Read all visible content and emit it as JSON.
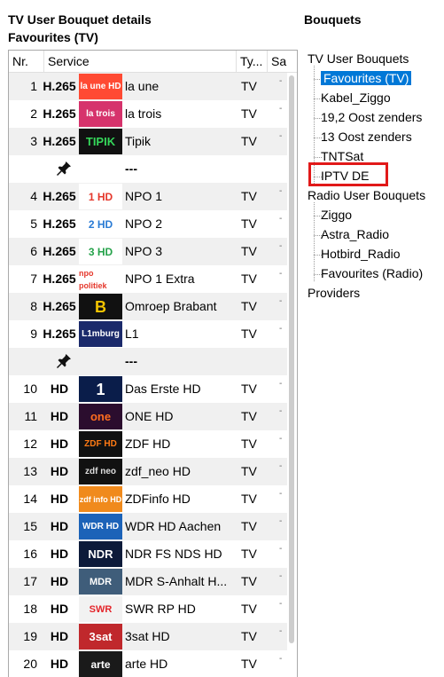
{
  "header": {
    "title": "TV User Bouquet details",
    "subtitle": "Favourites (TV)"
  },
  "bouquets_title": "Bouquets",
  "columns": {
    "nr": "Nr.",
    "service": "Service",
    "type": "Ty...",
    "sat": "Sa"
  },
  "rows": [
    {
      "nr": "1",
      "badge": "H.265",
      "logo": "la une HD",
      "name": "la une",
      "type": "TV"
    },
    {
      "nr": "2",
      "badge": "H.265",
      "logo": "la trois",
      "name": "la trois",
      "type": "TV"
    },
    {
      "nr": "3",
      "badge": "H.265",
      "logo": "TIPIK",
      "name": "Tipik",
      "type": "TV"
    },
    {
      "separator": true,
      "sep_text": "---"
    },
    {
      "nr": "4",
      "badge": "H.265",
      "logo": "1 HD",
      "name": "NPO 1",
      "type": "TV"
    },
    {
      "nr": "5",
      "badge": "H.265",
      "logo": "2 HD",
      "name": "NPO 2",
      "type": "TV"
    },
    {
      "nr": "6",
      "badge": "H.265",
      "logo": "3 HD",
      "name": "NPO 3",
      "type": "TV"
    },
    {
      "nr": "7",
      "badge": "H.265",
      "logo": "npo politiek",
      "name": "NPO 1 Extra",
      "type": "TV"
    },
    {
      "nr": "8",
      "badge": "H.265",
      "logo": "B",
      "name": "Omroep Brabant",
      "type": "TV"
    },
    {
      "nr": "9",
      "badge": "H.265",
      "logo": "L1mburg",
      "name": "L1",
      "type": "TV"
    },
    {
      "separator": true,
      "sep_text": "---"
    },
    {
      "nr": "10",
      "badge": "HD",
      "logo": "1",
      "name": "Das Erste HD",
      "type": "TV"
    },
    {
      "nr": "11",
      "badge": "HD",
      "logo": "one",
      "name": "ONE HD",
      "type": "TV"
    },
    {
      "nr": "12",
      "badge": "HD",
      "logo": "ZDF HD",
      "name": "ZDF HD",
      "type": "TV"
    },
    {
      "nr": "13",
      "badge": "HD",
      "logo": "zdf neo",
      "name": "zdf_neo HD",
      "type": "TV"
    },
    {
      "nr": "14",
      "badge": "HD",
      "logo": "zdf info HD",
      "name": "ZDFinfo HD",
      "type": "TV"
    },
    {
      "nr": "15",
      "badge": "HD",
      "logo": "WDR HD",
      "name": "WDR HD Aachen",
      "type": "TV"
    },
    {
      "nr": "16",
      "badge": "HD",
      "logo": "NDR",
      "name": "NDR FS NDS HD",
      "type": "TV"
    },
    {
      "nr": "17",
      "badge": "HD",
      "logo": "MDR",
      "name": "MDR S-Anhalt H...",
      "type": "TV"
    },
    {
      "nr": "18",
      "badge": "HD",
      "logo": "SWR",
      "name": "SWR RP HD",
      "type": "TV"
    },
    {
      "nr": "19",
      "badge": "HD",
      "logo": "3sat",
      "name": "3sat HD",
      "type": "TV"
    },
    {
      "nr": "20",
      "badge": "HD",
      "logo": "arte",
      "name": "arte HD",
      "type": "TV"
    }
  ],
  "tree": {
    "tv_root": "TV User Bouquets",
    "tv_children": [
      "Favourites (TV)",
      "Kabel_Ziggo",
      "19,2 Oost zenders",
      "13 Oost zenders",
      "TNTSat",
      "IPTV DE"
    ],
    "radio_root": "Radio User Bouquets",
    "radio_children": [
      "Ziggo",
      "Astra_Radio",
      "Hotbird_Radio",
      "Favourites (Radio)"
    ],
    "providers": "Providers",
    "selected": "Favourites (TV)",
    "highlighted": "IPTV DE"
  },
  "colors": {
    "selection": "#0078d7",
    "highlight_box": "#e11919",
    "alt_row": "#f0f0f0"
  }
}
